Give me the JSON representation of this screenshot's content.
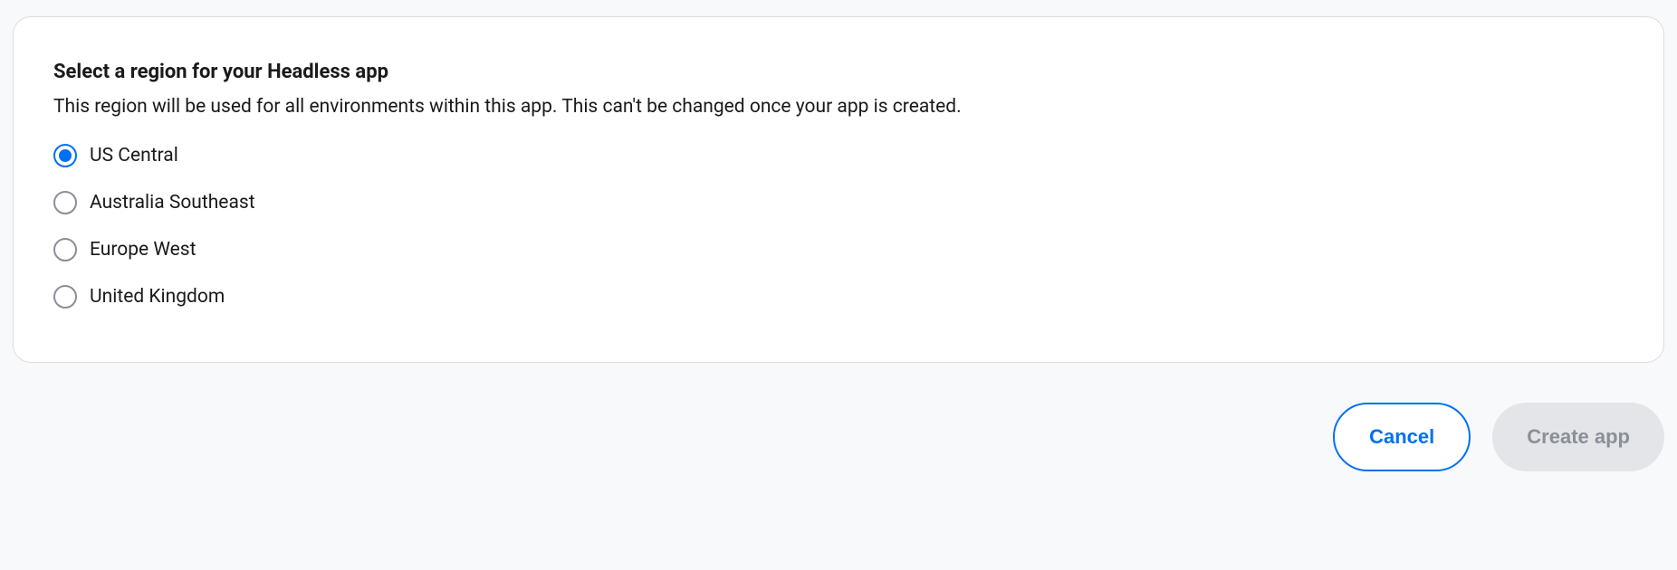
{
  "card": {
    "title": "Select a region for your Headless app",
    "description": "This region will be used for all environments within this app. This can't be changed once your app is created."
  },
  "regions": [
    {
      "id": "us-central",
      "label": "US Central",
      "selected": true
    },
    {
      "id": "australia-southeast",
      "label": "Australia Southeast",
      "selected": false
    },
    {
      "id": "europe-west",
      "label": "Europe West",
      "selected": false
    },
    {
      "id": "united-kingdom",
      "label": "United Kingdom",
      "selected": false
    }
  ],
  "actions": {
    "cancel": "Cancel",
    "create": "Create app"
  }
}
